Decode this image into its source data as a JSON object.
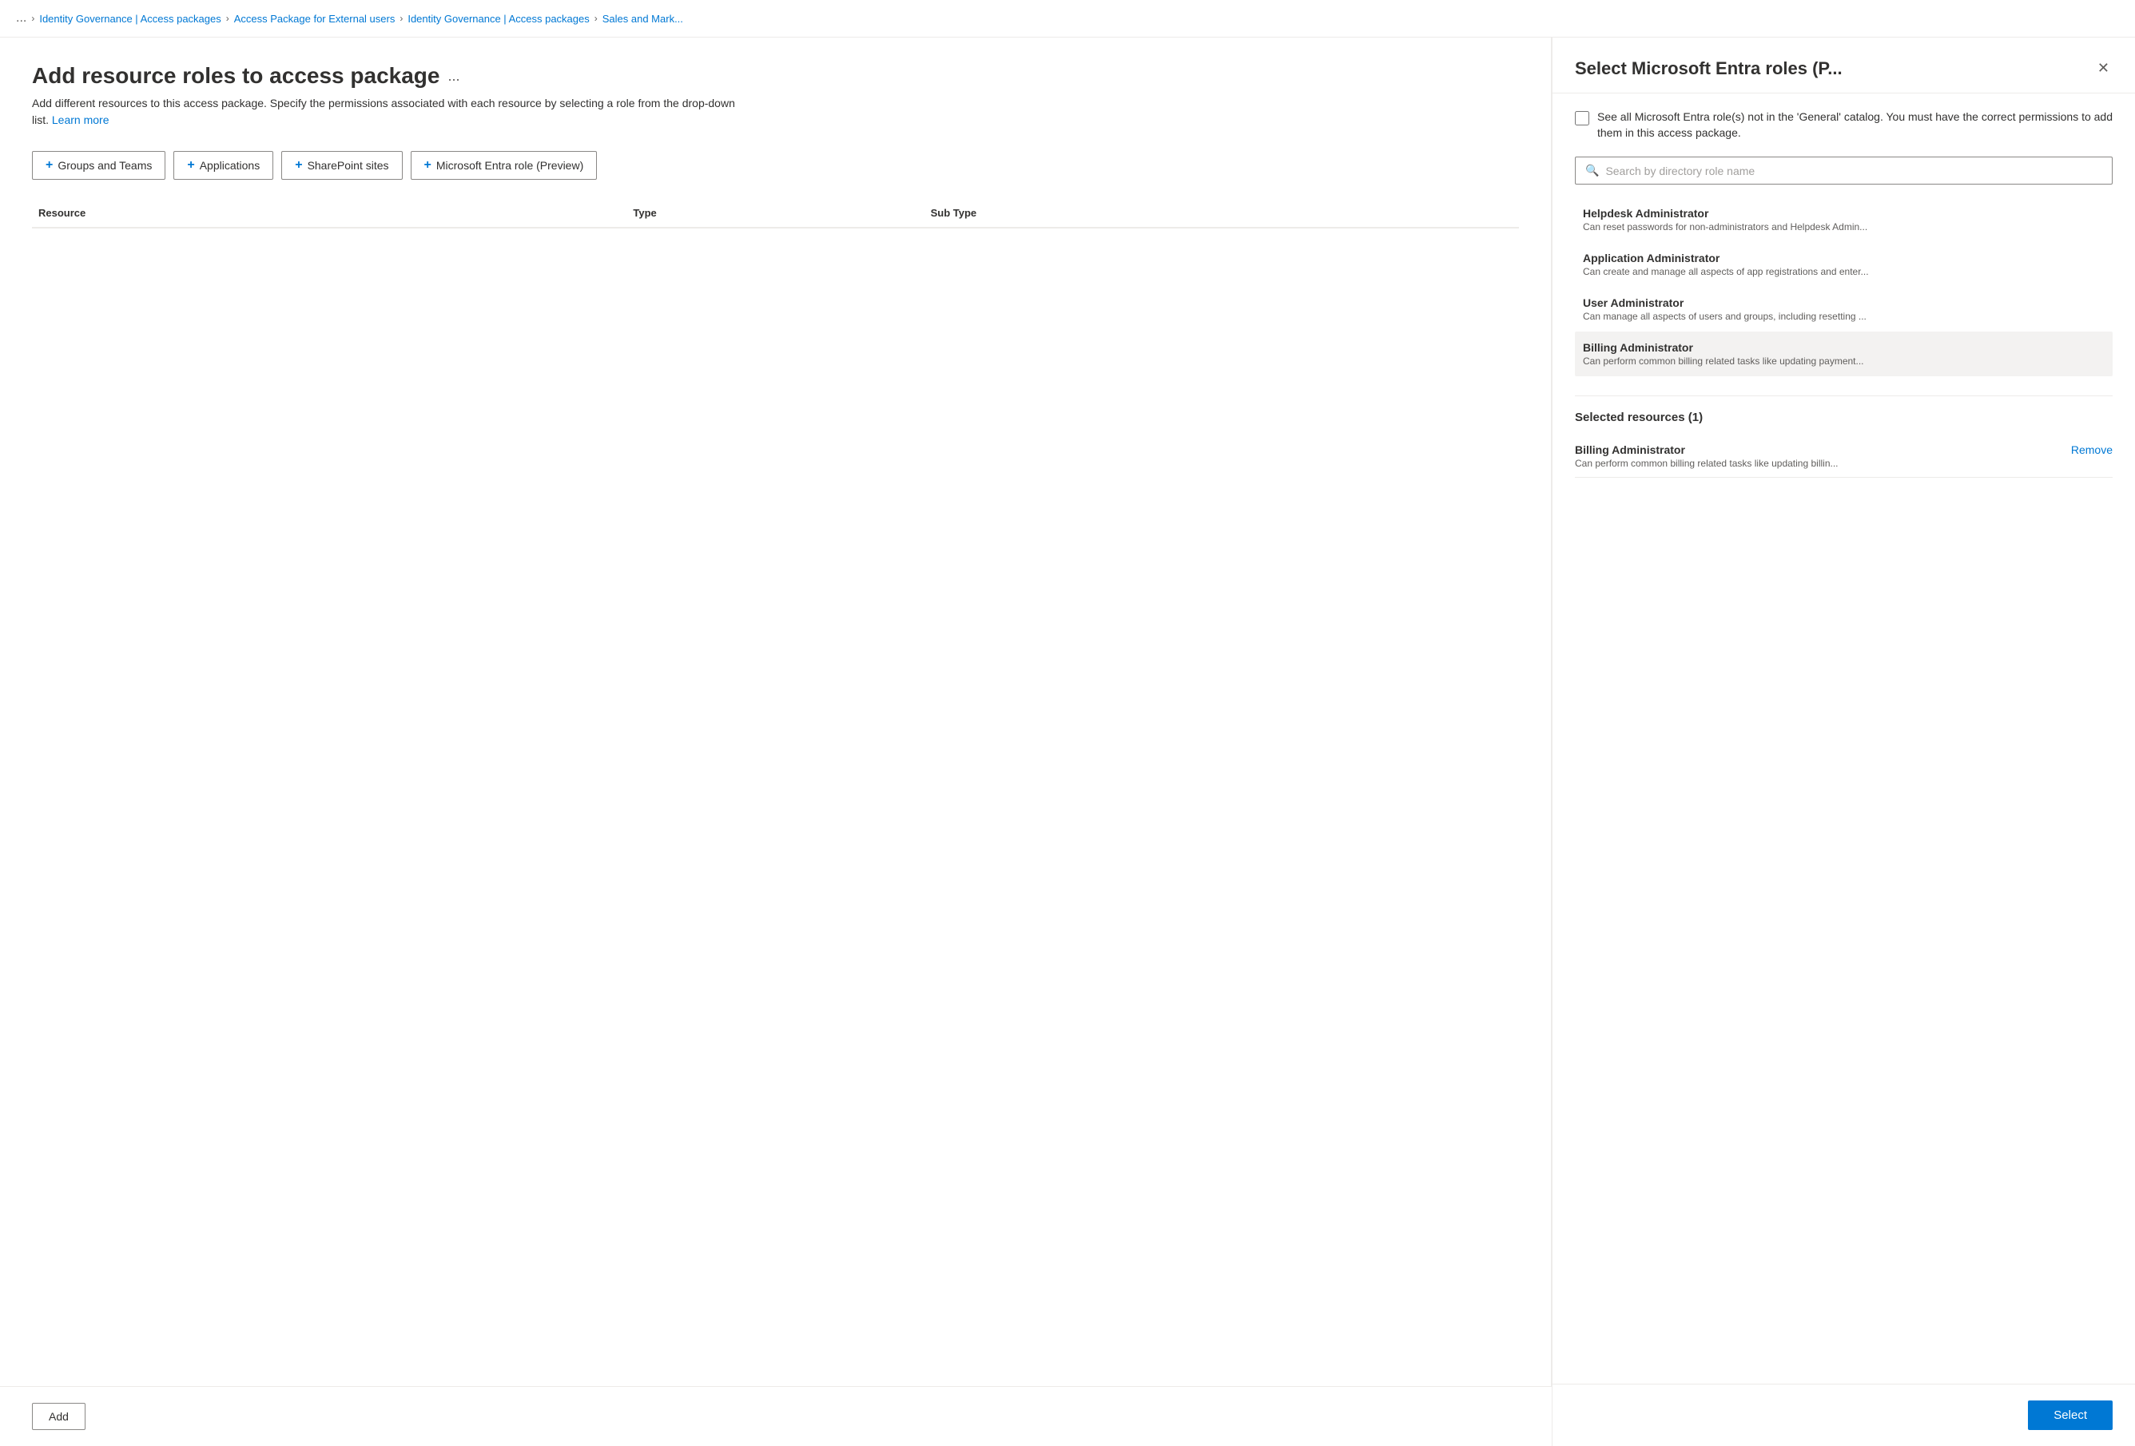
{
  "breadcrumb": {
    "dots": "...",
    "items": [
      {
        "label": "Identity Governance | Access packages",
        "link": true
      },
      {
        "label": "Access Package for External users",
        "link": true
      },
      {
        "label": "Identity Governance | Access packages",
        "link": true
      },
      {
        "label": "Sales and Mark...",
        "link": true
      }
    ]
  },
  "page": {
    "title": "Add resource roles to access package",
    "title_dots": "...",
    "description": "Add different resources to this access package. Specify the permissions associated with each resource by selecting a role from the drop-down list.",
    "learn_more": "Learn more"
  },
  "toolbar": {
    "buttons": [
      {
        "id": "groups-teams",
        "label": "Groups and Teams"
      },
      {
        "id": "applications",
        "label": "Applications"
      },
      {
        "id": "sharepoint-sites",
        "label": "SharePoint sites"
      },
      {
        "id": "entra-role",
        "label": "Microsoft Entra role (Preview)"
      }
    ]
  },
  "table": {
    "columns": [
      "Resource",
      "Type",
      "Sub Type",
      ""
    ]
  },
  "bottom_bar": {
    "add_label": "Add"
  },
  "panel": {
    "title": "Select Microsoft Entra roles (P...",
    "checkbox_label": "See all Microsoft Entra role(s) not in the 'General' catalog. You must have the correct permissions to add them in this access package.",
    "search_placeholder": "Search by directory role name",
    "roles": [
      {
        "id": "helpdesk-admin",
        "name": "Helpdesk Administrator",
        "desc": "Can reset passwords for non-administrators and Helpdesk Admin..."
      },
      {
        "id": "app-admin",
        "name": "Application Administrator",
        "desc": "Can create and manage all aspects of app registrations and enter..."
      },
      {
        "id": "user-admin",
        "name": "User Administrator",
        "desc": "Can manage all aspects of users and groups, including resetting ..."
      },
      {
        "id": "billing-admin",
        "name": "Billing Administrator",
        "desc": "Can perform common billing related tasks like updating payment...",
        "highlighted": true
      }
    ],
    "selected_section_title": "Selected resources (1)",
    "selected_items": [
      {
        "id": "billing-admin-selected",
        "name": "Billing Administrator",
        "desc": "Can perform common billing related tasks like updating billin...",
        "remove_label": "Remove"
      }
    ],
    "select_button_label": "Select",
    "close_label": "✕"
  }
}
